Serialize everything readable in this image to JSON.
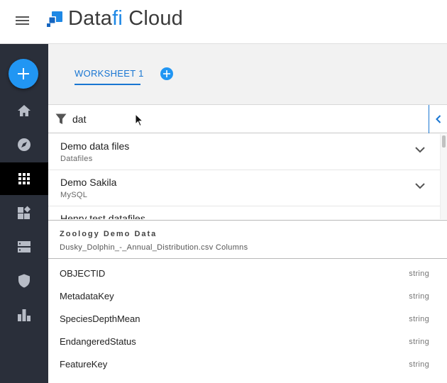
{
  "header": {
    "app_name_prefix": "Data",
    "app_name_accent": "fi",
    "app_name_suffix": " Cloud"
  },
  "sidebar": {
    "create_icon": "plus-icon",
    "items": [
      {
        "icon": "home-icon",
        "active": false
      },
      {
        "icon": "compass-icon",
        "active": false
      },
      {
        "icon": "grid-icon",
        "active": true
      },
      {
        "icon": "widgets-icon",
        "active": false
      },
      {
        "icon": "storage-icon",
        "active": false
      },
      {
        "icon": "shield-icon",
        "active": false
      },
      {
        "icon": "bar-chart-icon",
        "active": false
      }
    ]
  },
  "tabs": [
    {
      "label": "WORKSHEET 1",
      "active": true
    }
  ],
  "filter": {
    "value": "dat",
    "placeholder": ""
  },
  "sources": [
    {
      "name": "Demo data files",
      "type": "Datafiles"
    },
    {
      "name": "Demo Sakila",
      "type": "MySQL"
    },
    {
      "name": "Henry test datafiles",
      "type": ""
    }
  ],
  "dataset": {
    "title": "Zoology Demo Data",
    "subtitle": "Dusky_Dolphin_-_Annual_Distribution.csv Columns"
  },
  "columns": [
    {
      "name": "OBJECTID",
      "type": "string"
    },
    {
      "name": "MetadataKey",
      "type": "string"
    },
    {
      "name": "SpeciesDepthMean",
      "type": "string"
    },
    {
      "name": "EndangeredStatus",
      "type": "string"
    },
    {
      "name": "FeatureKey",
      "type": "string"
    }
  ],
  "colors": {
    "accent": "#1976d2",
    "fab": "#2196f3",
    "sidebar": "#2a2f3a"
  }
}
